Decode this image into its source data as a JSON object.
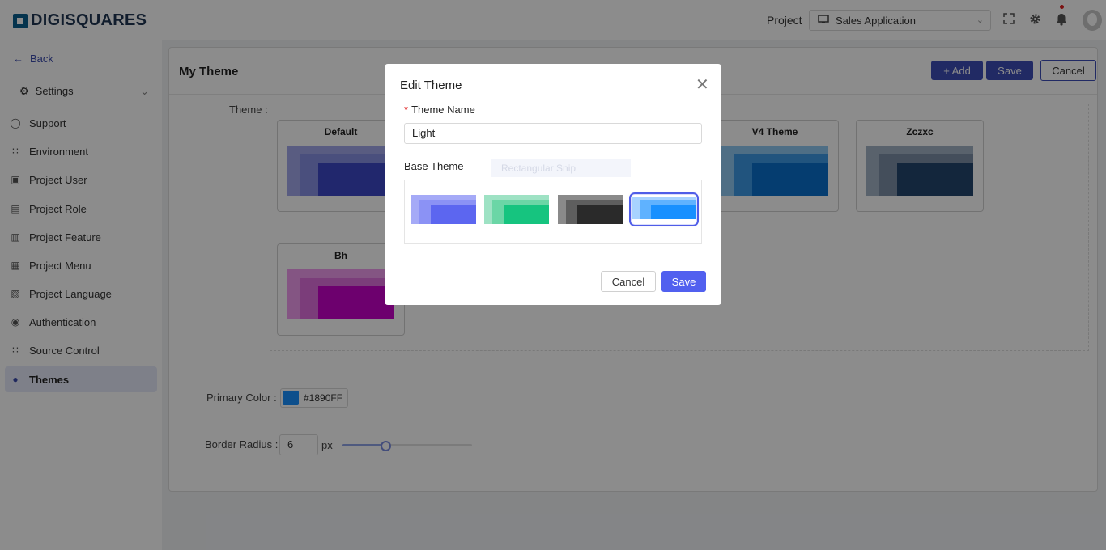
{
  "app": {
    "brand": "DIGISQUARES"
  },
  "header": {
    "project_label": "Project",
    "project_value": "Sales Application",
    "icons": [
      "fullscreen-icon",
      "gear-icon",
      "bell-icon",
      "avatar"
    ]
  },
  "sidebar": {
    "back_label": "Back",
    "settings_label": "Settings",
    "items": [
      {
        "label": "Support",
        "icon": "support-icon"
      },
      {
        "label": "Environment",
        "icon": "sliders-icon"
      },
      {
        "label": "Project User",
        "icon": "user-card-icon"
      },
      {
        "label": "Project Role",
        "icon": "role-icon"
      },
      {
        "label": "Project Feature",
        "icon": "feature-icon"
      },
      {
        "label": "Project Menu",
        "icon": "menu-icon"
      },
      {
        "label": "Project Language",
        "icon": "language-icon"
      },
      {
        "label": "Authentication",
        "icon": "fingerprint-icon"
      },
      {
        "label": "Source Control",
        "icon": "source-control-icon"
      },
      {
        "label": "Themes",
        "icon": "palette-icon",
        "active": true
      }
    ]
  },
  "main": {
    "title": "My Theme",
    "add_label": "+ Add",
    "save_label": "Save",
    "cancel_label": "Cancel",
    "theme_label": "Theme :",
    "themes": [
      {
        "name": "Default",
        "colors": [
          "#a2a8ec",
          "#8790e3",
          "#3d48c6"
        ]
      },
      {
        "name": "V4 Theme",
        "colors": [
          "#8ec8f3",
          "#3d9ae6",
          "#0a6fcc"
        ]
      },
      {
        "name": "Zczxc",
        "colors": [
          "#a3b2c5",
          "#7d8ea6",
          "#24456e"
        ]
      },
      {
        "name": "Bh",
        "colors": [
          "#f19cef",
          "#e070df",
          "#c700c8"
        ]
      }
    ],
    "primary_color_label": "Primary Color :",
    "primary_color": "#1890FF",
    "border_radius_label": "Border Radius :",
    "border_radius": "6",
    "border_radius_unit": "px",
    "border_radius_slider_fraction": 0.33
  },
  "modal": {
    "title": "Edit Theme",
    "required_mark": "*",
    "name_label": "Theme Name",
    "name_value": "Light",
    "base_label": "Base Theme",
    "ghost_text": "Rectangular Snip",
    "base_options": [
      {
        "colors": [
          "#a5aaf7",
          "#8b92f5",
          "#5c66f0"
        ],
        "selected": false
      },
      {
        "colors": [
          "#9ee2c4",
          "#6bd6a6",
          "#16c47f"
        ],
        "selected": false
      },
      {
        "colors": [
          "#8a8a8a",
          "#5e5e5e",
          "#2a2a2a"
        ],
        "selected": false
      },
      {
        "colors": [
          "#a8d3ff",
          "#5fb2ff",
          "#1890ff"
        ],
        "selected": true
      }
    ],
    "cancel_label": "Cancel",
    "save_label": "Save"
  }
}
